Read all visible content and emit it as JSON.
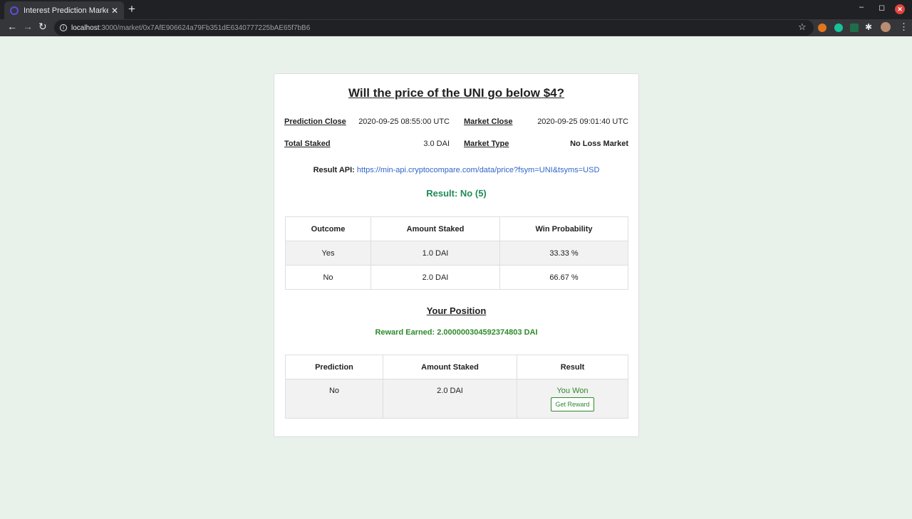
{
  "browser": {
    "tab_title": "Interest Prediction Marke",
    "url_host": "localhost",
    "url_path": ":3000/market/0x7AfE906624a79Fb351dE6340777225bAE65f7bB6"
  },
  "market": {
    "title": "Will the price of the UNI go below $4?",
    "prediction_close_label": "Prediction Close",
    "prediction_close_value": "2020-09-25 08:55:00 UTC",
    "market_close_label": "Market Close",
    "market_close_value": "2020-09-25 09:01:40 UTC",
    "total_staked_label": "Total Staked",
    "total_staked_value": "3.0 DAI",
    "market_type_label": "Market Type",
    "market_type_value": "No Loss Market",
    "result_api_label": "Result API:",
    "result_api_url": "https://min-api.cryptocompare.com/data/price?fsym=UNI&tsyms=USD",
    "result": "Result: No (5)"
  },
  "outcomes": {
    "headers": [
      "Outcome",
      "Amount Staked",
      "Win Probability"
    ],
    "rows": [
      [
        "Yes",
        "1.0 DAI",
        "33.33 %"
      ],
      [
        "No",
        "2.0 DAI",
        "66.67 %"
      ]
    ]
  },
  "position": {
    "title": "Your Position",
    "reward_earned": "Reward Earned: 2.000000304592374803 DAI",
    "headers": [
      "Prediction",
      "Amount Staked",
      "Result"
    ],
    "row": {
      "prediction": "No",
      "amount": "2.0 DAI",
      "result": "You Won",
      "button": "Get Reward"
    }
  },
  "colors": {
    "page_bg": "#e9f2ea",
    "result_green": "#1f8a57",
    "reward_green": "#2e8a2b",
    "link_blue": "#2f66c7"
  }
}
